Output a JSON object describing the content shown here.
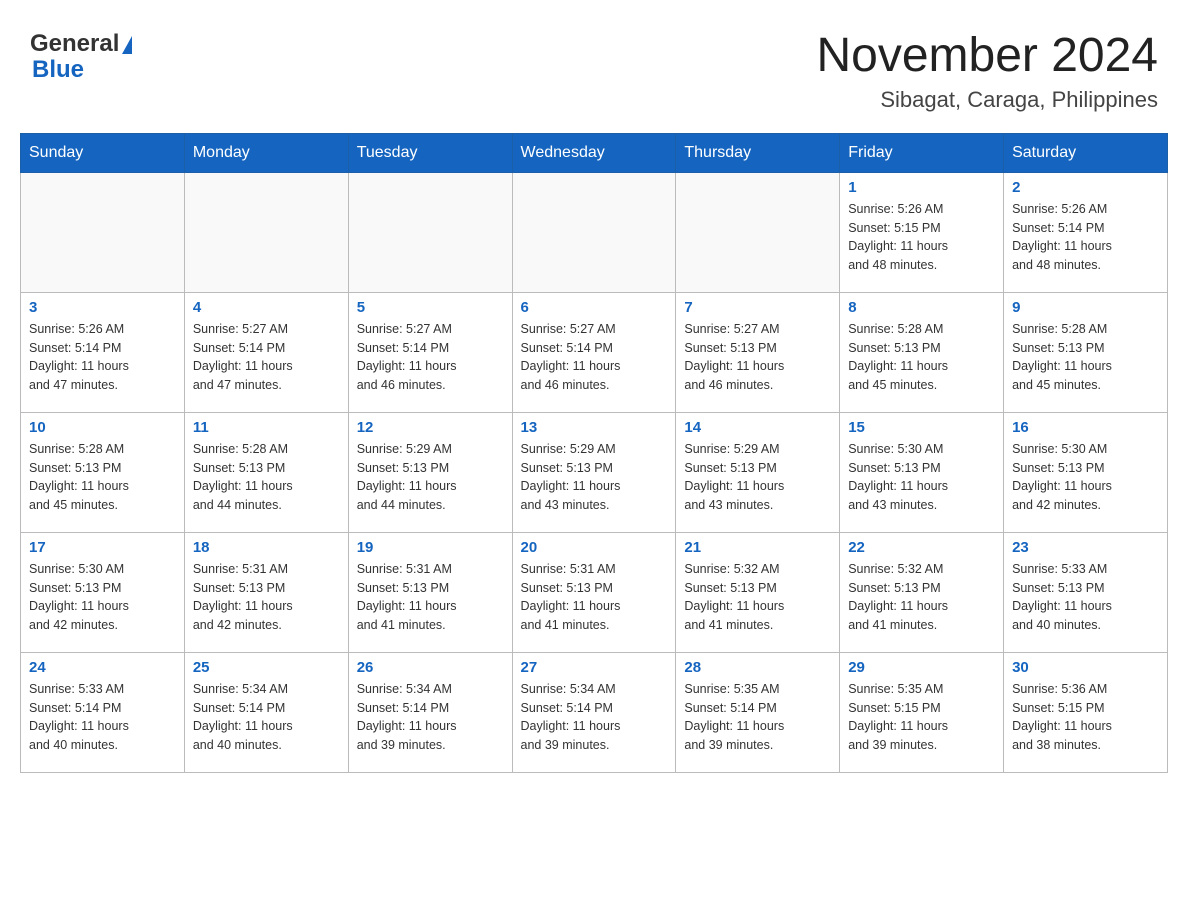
{
  "header": {
    "logo_general": "General",
    "logo_blue": "Blue",
    "month_title": "November 2024",
    "location": "Sibagat, Caraga, Philippines"
  },
  "days_of_week": [
    "Sunday",
    "Monday",
    "Tuesday",
    "Wednesday",
    "Thursday",
    "Friday",
    "Saturday"
  ],
  "weeks": [
    [
      {
        "day": "",
        "info": ""
      },
      {
        "day": "",
        "info": ""
      },
      {
        "day": "",
        "info": ""
      },
      {
        "day": "",
        "info": ""
      },
      {
        "day": "",
        "info": ""
      },
      {
        "day": "1",
        "info": "Sunrise: 5:26 AM\nSunset: 5:15 PM\nDaylight: 11 hours\nand 48 minutes."
      },
      {
        "day": "2",
        "info": "Sunrise: 5:26 AM\nSunset: 5:14 PM\nDaylight: 11 hours\nand 48 minutes."
      }
    ],
    [
      {
        "day": "3",
        "info": "Sunrise: 5:26 AM\nSunset: 5:14 PM\nDaylight: 11 hours\nand 47 minutes."
      },
      {
        "day": "4",
        "info": "Sunrise: 5:27 AM\nSunset: 5:14 PM\nDaylight: 11 hours\nand 47 minutes."
      },
      {
        "day": "5",
        "info": "Sunrise: 5:27 AM\nSunset: 5:14 PM\nDaylight: 11 hours\nand 46 minutes."
      },
      {
        "day": "6",
        "info": "Sunrise: 5:27 AM\nSunset: 5:14 PM\nDaylight: 11 hours\nand 46 minutes."
      },
      {
        "day": "7",
        "info": "Sunrise: 5:27 AM\nSunset: 5:13 PM\nDaylight: 11 hours\nand 46 minutes."
      },
      {
        "day": "8",
        "info": "Sunrise: 5:28 AM\nSunset: 5:13 PM\nDaylight: 11 hours\nand 45 minutes."
      },
      {
        "day": "9",
        "info": "Sunrise: 5:28 AM\nSunset: 5:13 PM\nDaylight: 11 hours\nand 45 minutes."
      }
    ],
    [
      {
        "day": "10",
        "info": "Sunrise: 5:28 AM\nSunset: 5:13 PM\nDaylight: 11 hours\nand 45 minutes."
      },
      {
        "day": "11",
        "info": "Sunrise: 5:28 AM\nSunset: 5:13 PM\nDaylight: 11 hours\nand 44 minutes."
      },
      {
        "day": "12",
        "info": "Sunrise: 5:29 AM\nSunset: 5:13 PM\nDaylight: 11 hours\nand 44 minutes."
      },
      {
        "day": "13",
        "info": "Sunrise: 5:29 AM\nSunset: 5:13 PM\nDaylight: 11 hours\nand 43 minutes."
      },
      {
        "day": "14",
        "info": "Sunrise: 5:29 AM\nSunset: 5:13 PM\nDaylight: 11 hours\nand 43 minutes."
      },
      {
        "day": "15",
        "info": "Sunrise: 5:30 AM\nSunset: 5:13 PM\nDaylight: 11 hours\nand 43 minutes."
      },
      {
        "day": "16",
        "info": "Sunrise: 5:30 AM\nSunset: 5:13 PM\nDaylight: 11 hours\nand 42 minutes."
      }
    ],
    [
      {
        "day": "17",
        "info": "Sunrise: 5:30 AM\nSunset: 5:13 PM\nDaylight: 11 hours\nand 42 minutes."
      },
      {
        "day": "18",
        "info": "Sunrise: 5:31 AM\nSunset: 5:13 PM\nDaylight: 11 hours\nand 42 minutes."
      },
      {
        "day": "19",
        "info": "Sunrise: 5:31 AM\nSunset: 5:13 PM\nDaylight: 11 hours\nand 41 minutes."
      },
      {
        "day": "20",
        "info": "Sunrise: 5:31 AM\nSunset: 5:13 PM\nDaylight: 11 hours\nand 41 minutes."
      },
      {
        "day": "21",
        "info": "Sunrise: 5:32 AM\nSunset: 5:13 PM\nDaylight: 11 hours\nand 41 minutes."
      },
      {
        "day": "22",
        "info": "Sunrise: 5:32 AM\nSunset: 5:13 PM\nDaylight: 11 hours\nand 41 minutes."
      },
      {
        "day": "23",
        "info": "Sunrise: 5:33 AM\nSunset: 5:13 PM\nDaylight: 11 hours\nand 40 minutes."
      }
    ],
    [
      {
        "day": "24",
        "info": "Sunrise: 5:33 AM\nSunset: 5:14 PM\nDaylight: 11 hours\nand 40 minutes."
      },
      {
        "day": "25",
        "info": "Sunrise: 5:34 AM\nSunset: 5:14 PM\nDaylight: 11 hours\nand 40 minutes."
      },
      {
        "day": "26",
        "info": "Sunrise: 5:34 AM\nSunset: 5:14 PM\nDaylight: 11 hours\nand 39 minutes."
      },
      {
        "day": "27",
        "info": "Sunrise: 5:34 AM\nSunset: 5:14 PM\nDaylight: 11 hours\nand 39 minutes."
      },
      {
        "day": "28",
        "info": "Sunrise: 5:35 AM\nSunset: 5:14 PM\nDaylight: 11 hours\nand 39 minutes."
      },
      {
        "day": "29",
        "info": "Sunrise: 5:35 AM\nSunset: 5:15 PM\nDaylight: 11 hours\nand 39 minutes."
      },
      {
        "day": "30",
        "info": "Sunrise: 5:36 AM\nSunset: 5:15 PM\nDaylight: 11 hours\nand 38 minutes."
      }
    ]
  ]
}
